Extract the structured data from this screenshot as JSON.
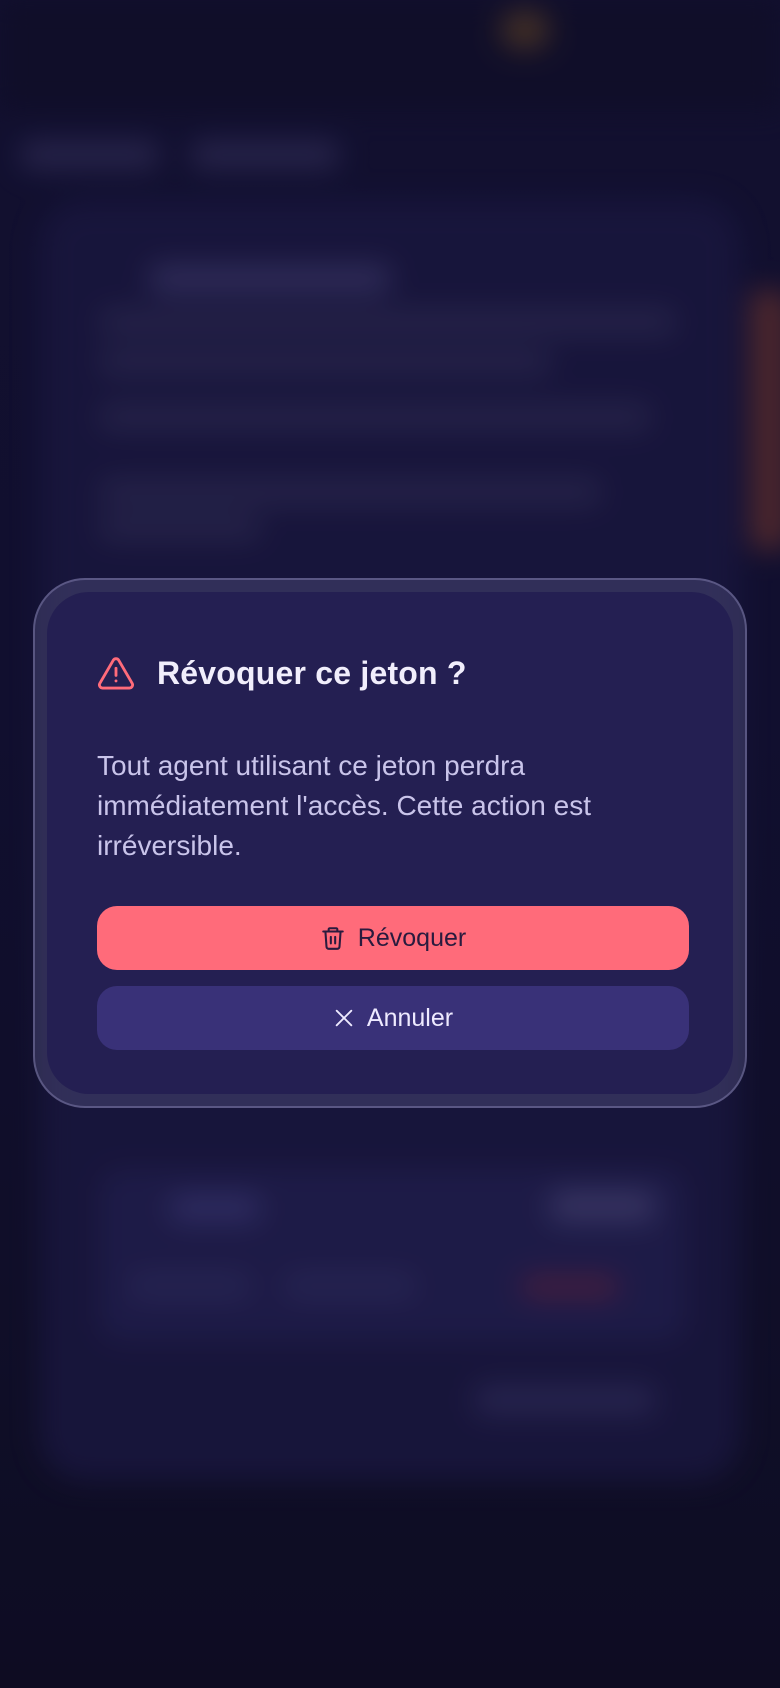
{
  "dialog": {
    "title": "Révoquer ce jeton ?",
    "message": "Tout agent utilisant ce jeton perdra immédiatement l'accès. Cette action est irréversible.",
    "warning_icon": "warning-triangle-icon",
    "revoke_button": {
      "label": "Révoquer",
      "icon": "trash-icon"
    },
    "cancel_button": {
      "label": "Annuler",
      "icon": "close-icon"
    }
  },
  "colors": {
    "dialog_bg": "#241f52",
    "danger": "#ff6b7a",
    "cancel_bg": "#393178",
    "title_text": "#f1eefc",
    "body_text": "#c9c4ea"
  }
}
